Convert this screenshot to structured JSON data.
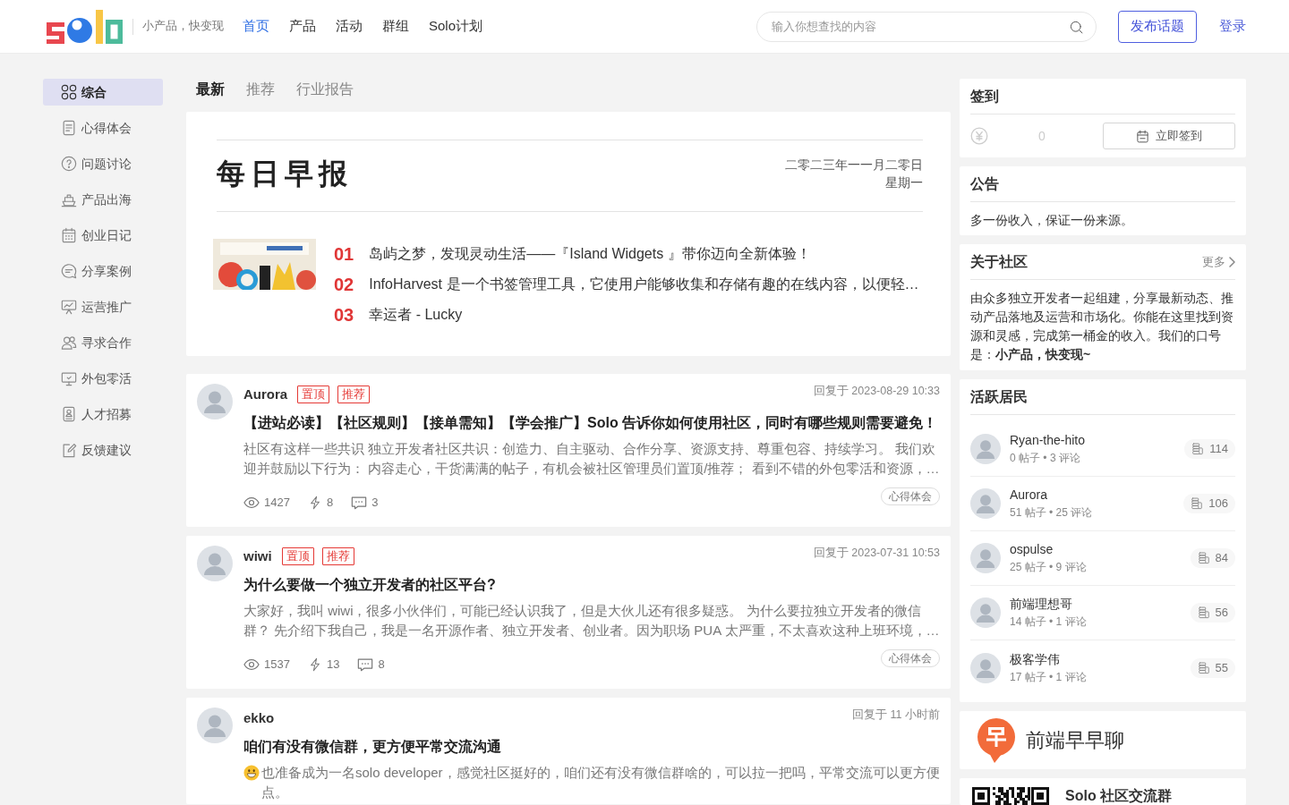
{
  "header": {
    "tagline": "小产品，快变现",
    "nav": [
      {
        "label": "首页",
        "selected": true
      },
      {
        "label": "产品",
        "selected": false
      },
      {
        "label": "活动",
        "selected": false
      },
      {
        "label": "群组",
        "selected": false
      },
      {
        "label": "Solo计划",
        "selected": false
      }
    ],
    "search": {
      "placeholder": "输入你想查找的内容"
    },
    "publish_button": "发布话题",
    "login_link": "登录"
  },
  "sidebar": {
    "items": [
      {
        "label": "综合",
        "selected": true
      },
      {
        "label": "心得体会",
        "selected": false
      },
      {
        "label": "问题讨论",
        "selected": false
      },
      {
        "label": "产品出海",
        "selected": false
      },
      {
        "label": "创业日记",
        "selected": false
      },
      {
        "label": "分享案例",
        "selected": false
      },
      {
        "label": "运营推广",
        "selected": false
      },
      {
        "label": "寻求合作",
        "selected": false
      },
      {
        "label": "外包零活",
        "selected": false
      },
      {
        "label": "人才招募",
        "selected": false
      },
      {
        "label": "反馈建议",
        "selected": false
      }
    ]
  },
  "feed_tabs": [
    {
      "label": "最新",
      "selected": true
    },
    {
      "label": "推荐",
      "selected": false
    },
    {
      "label": "行业报告",
      "selected": false
    }
  ],
  "daily_report": {
    "title": "每日早报",
    "date": "二零二三年一一月二零日",
    "weekday": "星期一",
    "items": [
      {
        "number": "01",
        "text": "岛屿之梦，发现灵动生活——『Island Widgets 』带你迈向全新体验！"
      },
      {
        "number": "02",
        "text": "InfoHarvest 是一个书签管理工具，它使用户能够收集和存储有趣的在线内容，以便轻…"
      },
      {
        "number": "03",
        "text": "幸运者 - Lucky"
      }
    ]
  },
  "posts": [
    {
      "author": "Aurora",
      "badges": [
        "置顶",
        "推荐"
      ],
      "time": "回复于 2023-08-29 10:33",
      "title": "【进站必读】【社区规则】【接单需知】【学会推广】Solo 告诉你如何使用社区，同时有哪些规则需要避免！",
      "excerpt": "社区有这样一些共识 独立开发者社区共识：创造力、自主驱动、合作分享、资源支持、尊重包容、持续学习。 我们欢迎并鼓励以下行为： 内容走心，干货满满的帖子，有机会被社区管理员们置顶/推荐； 看到不错的外包零活和资源，…",
      "views": "1427",
      "likes": "8",
      "comments": "3",
      "tag": "心得体会"
    },
    {
      "author": "wiwi",
      "badges": [
        "置顶",
        "推荐"
      ],
      "time": "回复于 2023-07-31 10:53",
      "title": "为什么要做一个独立开发者的社区平台?",
      "excerpt": "大家好，我叫 wiwi，很多小伙伴们，可能已经认识我了，但是大伙儿还有很多疑惑。 为什么要拉独立开发者的微信群？ 先介绍下我自己，我是一名开源作者、独立开发者、创业者。因为职场 PUA 太严重，不太喜欢这种上班环境，…",
      "views": "1537",
      "likes": "13",
      "comments": "8",
      "tag": "心得体会"
    },
    {
      "author": "ekko",
      "time": "回复于 11 小时前",
      "title": "咱们有没有微信群，更方便平常交流沟通",
      "leading_emoji": true,
      "excerpt": "也准备成为一名solo developer，感觉社区挺好的，咱们还有没有微信群啥的，可以拉一把吗，平常交流可以更方便点。"
    }
  ],
  "right_panel": {
    "checkin": {
      "title": "签到",
      "points": "0",
      "button": "立即签到"
    },
    "notice": {
      "title": "公告",
      "text": "多一份收入，保证一份来源。"
    },
    "about": {
      "title": "关于社区",
      "more": "更多",
      "text": "由众多独立开发者一起组建，分享最新动态、推动产品落地及运营和市场化。你能在这里找到资源和灵感，完成第一桶金的收入。我们的口号是：**小产品，快变现~**"
    },
    "residents": {
      "title": "活跃居民",
      "items": [
        {
          "name": "Ryan-the-hito",
          "stats": "0 帖子 • 3 评论",
          "points": "114"
        },
        {
          "name": "Aurora",
          "stats": "51 帖子 • 25 评论",
          "points": "106"
        },
        {
          "name": "ospulse",
          "stats": "25 帖子 • 9 评论",
          "points": "84"
        },
        {
          "name": "前端理想哥",
          "stats": "14 帖子 • 1 评论",
          "points": "56"
        },
        {
          "name": "极客学伟",
          "stats": "17 帖子 • 1 评论",
          "points": "55"
        }
      ]
    },
    "promo": {
      "title": "前端早早聊"
    },
    "group": {
      "title": "Solo 社区交流群"
    }
  }
}
